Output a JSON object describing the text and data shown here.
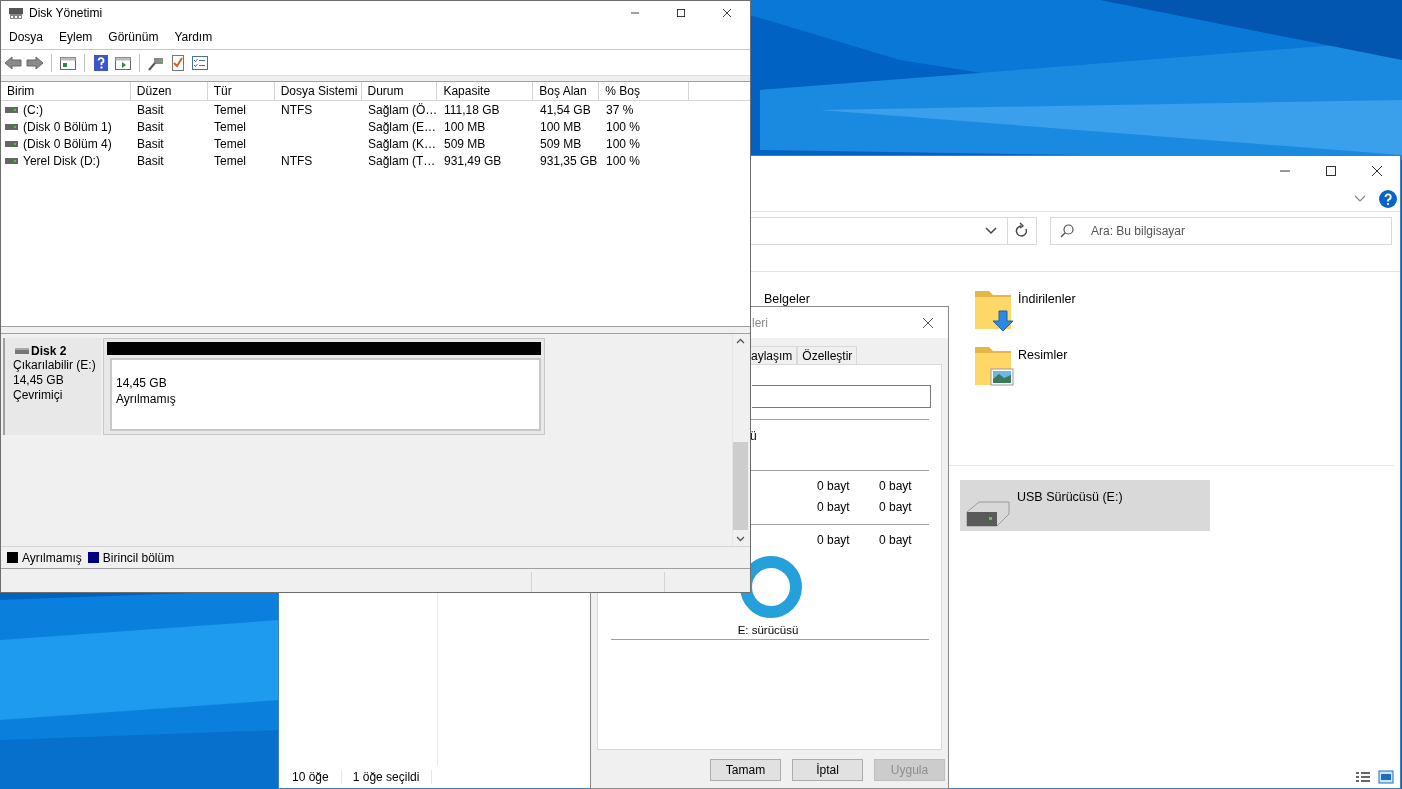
{
  "explorer": {
    "search": {
      "placeholder": "Ara: Bu bilgisayar"
    },
    "folder_columns": [
      [
        {
          "label": "Belgeler"
        }
      ],
      [
        {
          "label": "İndirilenler",
          "kind": "download"
        },
        {
          "label": "Resimler",
          "kind": "picture"
        }
      ]
    ],
    "drives": [
      {
        "label": "USB Sürücüsü (E:)",
        "selected": true
      }
    ],
    "status_bar": [
      "10 öğe",
      "1 öğe seçildi"
    ]
  },
  "properties_dialog": {
    "title": "leri",
    "tabs": [
      {
        "label": "aylaşım",
        "selected": false
      },
      {
        "label": "Özelleştir",
        "selected": false
      }
    ],
    "type_label": "ü",
    "space_groups": [
      [
        [
          "0 bayt",
          "0 bayt"
        ],
        [
          "0 bayt",
          "0 bayt"
        ]
      ],
      [
        [
          "0 bayt",
          "0 bayt"
        ]
      ]
    ],
    "drive_caption": "E: sürücüsü",
    "buttons": [
      {
        "label": "Tamam",
        "disabled": false
      },
      {
        "label": "İptal",
        "disabled": false
      },
      {
        "label": "Uygula",
        "disabled": true
      }
    ]
  },
  "disk_management": {
    "window": {
      "title": "Disk Yönetimi"
    },
    "menu": [
      "Dosya",
      "Eylem",
      "Görünüm",
      "Yardım"
    ],
    "table": {
      "columns": [
        "Birim",
        "Düzen",
        "Tür",
        "Dosya Sistemi",
        "Durum",
        "Kapasite",
        "Boş Alan",
        "% Boş"
      ],
      "rows": [
        {
          "cells": [
            "(C:)",
            "Basit",
            "Temel",
            "NTFS",
            "Sağlam (Ö…",
            "111,18 GB",
            "41,54 GB",
            "37 %"
          ]
        },
        {
          "cells": [
            "(Disk 0 Bölüm 1)",
            "Basit",
            "Temel",
            "",
            "Sağlam (E…",
            "100 MB",
            "100 MB",
            "100 %"
          ]
        },
        {
          "cells": [
            "(Disk 0 Bölüm 4)",
            "Basit",
            "Temel",
            "",
            "Sağlam (K…",
            "509 MB",
            "509 MB",
            "100 %"
          ]
        },
        {
          "cells": [
            "Yerel Disk (D:)",
            "Basit",
            "Temel",
            "NTFS",
            "Sağlam (T…",
            "931,49 GB",
            "931,35 GB",
            "100 %"
          ]
        }
      ]
    },
    "disks": [
      {
        "name": "Disk 2",
        "type": "Çıkarılabilir (E:)",
        "size": "14,45 GB",
        "status": "Çevrimiçi",
        "partitions": [
          {
            "size": "14,45 GB",
            "label": "Ayrılmamış",
            "kind": "unallocated"
          }
        ]
      }
    ],
    "legend": [
      {
        "label": "Ayrılmamış",
        "color": "#000000"
      },
      {
        "label": "Birincil bölüm",
        "color": "#000080"
      }
    ]
  }
}
